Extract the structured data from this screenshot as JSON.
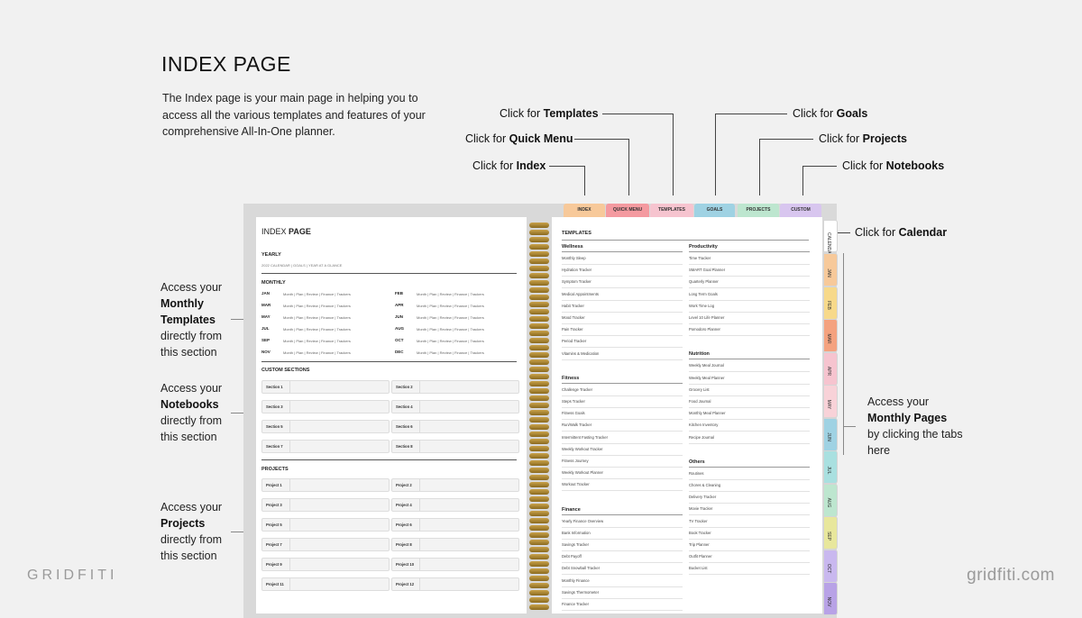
{
  "title": "INDEX PAGE",
  "intro": "The Index page is your main page in helping you to access all the various templates and features of your comprehensive All-In-One planner.",
  "callouts": {
    "templates": {
      "prefix": "Click for ",
      "bold": "Templates"
    },
    "quick_menu": {
      "prefix": "Click for ",
      "bold": "Quick Menu"
    },
    "index": {
      "prefix": "Click for ",
      "bold": "Index"
    },
    "goals": {
      "prefix": "Click for ",
      "bold": "Goals"
    },
    "projects": {
      "prefix": "Click for ",
      "bold": "Projects"
    },
    "notebooks": {
      "prefix": "Click for ",
      "bold": "Notebooks"
    },
    "calendar": {
      "prefix": "Click for ",
      "bold": "Calendar"
    }
  },
  "side_notes": {
    "monthly": {
      "pre": "Access your",
      "bold": "Monthly Templates",
      "post": "directly from this section"
    },
    "notebooks": {
      "pre": "Access your",
      "bold": "Notebooks",
      "post": "directly from this section"
    },
    "projects": {
      "pre": "Access your",
      "bold": "Projects",
      "post": "directly from this section"
    },
    "monthly_pages": {
      "pre": "Access your",
      "bold": "Monthly Pages",
      "post": "by clicking the tabs here"
    }
  },
  "brand": {
    "left": "GRIDFITI",
    "right": "gridfiti.com"
  },
  "top_tabs": [
    {
      "label": "INDEX",
      "color": "#f7c99a"
    },
    {
      "label": "QUICK MENU",
      "color": "#f49aa0"
    },
    {
      "label": "TEMPLATES",
      "color": "#f6c4cf"
    },
    {
      "label": "GOALS",
      "color": "#9fd2e3"
    },
    {
      "label": "PROJECTS",
      "color": "#bde6cf"
    },
    {
      "label": "CUSTOM",
      "color": "#d8c6ef"
    }
  ],
  "side_tabs": [
    {
      "label": "CALENDAR",
      "color": "#ffffff"
    },
    {
      "label": "JAN",
      "color": "#f7c99a"
    },
    {
      "label": "FEB",
      "color": "#f7d98a"
    },
    {
      "label": "MAR",
      "color": "#f4a27f"
    },
    {
      "label": "APR",
      "color": "#f6c4cf"
    },
    {
      "label": "MAY",
      "color": "#f8d2d8"
    },
    {
      "label": "JUN",
      "color": "#9fd2e3"
    },
    {
      "label": "JUL",
      "color": "#a9e0e0"
    },
    {
      "label": "AUG",
      "color": "#bde6cf"
    },
    {
      "label": "SEP",
      "color": "#e8e79c"
    },
    {
      "label": "OCT",
      "color": "#c9b8ef"
    },
    {
      "label": "NOV",
      "color": "#b8a2e6"
    }
  ],
  "left_page": {
    "title_light": "INDEX",
    "title_bold": "PAGE",
    "yearly_label": "YEARLY",
    "yearly_links": "2022 CALENDAR   |   GOALS   |   YEAR AT A GLANCE",
    "monthly_label": "MONTHLY",
    "months": [
      "JAN",
      "FEB",
      "MAR",
      "APR",
      "MAY",
      "JUN",
      "JUL",
      "AUG",
      "SEP",
      "OCT",
      "NOV",
      "DEC"
    ],
    "month_links": "Month  |  Plan  |  Review  |  Finance  |  Trackers",
    "custom_label": "CUSTOM SECTIONS",
    "sections": [
      "Section 1",
      "Section 2",
      "Section 3",
      "Section 4",
      "Section 5",
      "Section 6",
      "Section 7",
      "Section 8"
    ],
    "projects_label": "PROJECTS",
    "projects": [
      "Project 1",
      "Project 2",
      "Project 3",
      "Project 4",
      "Project 5",
      "Project 6",
      "Project 7",
      "Project 8",
      "Project 9",
      "Project 10",
      "Project 11",
      "Project 12"
    ]
  },
  "right_page": {
    "header": "TEMPLATES",
    "left_col": [
      {
        "heading": "Wellness",
        "items": [
          "Monthly Sleep",
          "Hydration Tracker",
          "Symptom Tracker",
          "Medical Appointments",
          "Habit Tracker",
          "Mood Tracker",
          "Pain Tracker",
          "Period Tracker",
          "Vitamins & Medication"
        ]
      },
      {
        "heading": "Fitness",
        "items": [
          "Challenge Tracker",
          "Steps Tracker",
          "Fitness Goals",
          "Run/Walk Tracker",
          "Intermittent Fasting Tracker",
          "Weekly Workout Tracker",
          "Fitness Journey",
          "Weekly Workout Planner",
          "Workout Tracker"
        ]
      },
      {
        "heading": "Finance",
        "items": [
          "Yearly Finance Overview",
          "Bank Information",
          "Savings Tracker",
          "Debt Payoff",
          "Debt Snowball Tracker",
          "Monthly Finance",
          "Savings Thermometer",
          "Finance Tracker"
        ]
      }
    ],
    "right_col": [
      {
        "heading": "Productivity",
        "items": [
          "Time Tracker",
          "SMART Goal Planner",
          "Quarterly Planner",
          "Long Term Goals",
          "Work Time Log",
          "Level 10 Life Planner",
          "Pomodoro Planner"
        ]
      },
      {
        "heading": "Nutrition",
        "items": [
          "Weekly Meal Journal",
          "Weekly Meal Planner",
          "Grocery List",
          "Food Journal",
          "Monthly Meal Planner",
          "Kitchen Inventory",
          "Recipe Journal"
        ]
      },
      {
        "heading": "Others",
        "items": [
          "Routines",
          "Chores & Cleaning",
          "Delivery Tracker",
          "Movie Tracker",
          "TV Tracker",
          "Book Tracker",
          "Trip Planner",
          "Outfit Planner",
          "Bucket List"
        ]
      }
    ]
  }
}
